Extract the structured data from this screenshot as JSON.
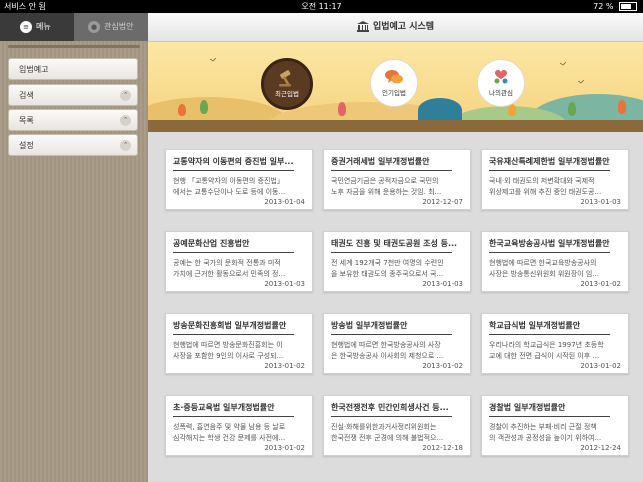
{
  "status_bar": {
    "carrier": "서비스 안 됨",
    "time": "오전 11:17",
    "battery": "72 %",
    "battery_level": 0.72
  },
  "sidebar": {
    "tabs": [
      {
        "label": "메뉴",
        "icon": "list-icon",
        "active": true
      },
      {
        "label": "관심법안",
        "icon": "person-icon",
        "active": false
      }
    ],
    "items": [
      {
        "label": "입법예고",
        "chevron": false
      },
      {
        "label": "검색",
        "chevron": true
      },
      {
        "label": "목록",
        "chevron": true
      },
      {
        "label": "설정",
        "chevron": true
      }
    ]
  },
  "header": {
    "title": "입법예고 시스템",
    "icon": "capitol-building-icon"
  },
  "banner": {
    "buttons": [
      {
        "label": "최근입법",
        "icon": "gavel-icon",
        "active": true
      },
      {
        "label": "인기입법",
        "icon": "chat-bubbles-icon",
        "active": false
      },
      {
        "label": "나의관심",
        "icon": "heart-person-icon",
        "active": false
      }
    ]
  },
  "cards": [
    {
      "title": "교통약자의 이동편의 증진법 일부...",
      "body1": "현행 「교통약자의 이동편의 증진법」",
      "body2": "에서는 교통수단이나 도로 등에 이동...",
      "date": "2013-01-04"
    },
    {
      "title": "증권거래세법 일부개정법률안",
      "body1": "국민연금기금은 공적자금으로 국민의",
      "body2": "노후 자금을 위해 운용하는 것임. 최...",
      "date": "2012-12-07"
    },
    {
      "title": "국유재산특례제한법 일부개정법률안",
      "body1": "국내·외 태권도의 저변확대와 국제적",
      "body2": "위상제고를 위해 추진 중인 태권도공...",
      "date": "2013-01-03"
    },
    {
      "title": "공예문화산업 진흥법안",
      "body1": "공예는 한 국가의 문화적 전통과 미적",
      "body2": "가치에 근거한 활동으로서 민족의 정...",
      "date": "2013-01-03"
    },
    {
      "title": "태권도 진흥 및 태권도공원 조성 등...",
      "body1": "전 세계 192개국 7천만 여명의 수련인",
      "body2": "을 보유한 태권도의 종주국으로서 국...",
      "date": "2013-01-03"
    },
    {
      "title": "한국교육방송공사법 일부개정법률안",
      "body1": "현행법에 따르면 한국교육방송공사의",
      "body2": "사장은 방송통신위원회 위원장이 임...",
      "date": "2013-01-02"
    },
    {
      "title": "방송문화진흥회법 일부개정법률안",
      "body1": "현행법에 따르면 방송문화진흥회는 이",
      "body2": "사장을 포함한 9인의 이사로 구성되...",
      "date": "2013-01-02"
    },
    {
      "title": "방송법 일부개정법률안",
      "body1": "현행법에 따르면 한국방송공사의 사장",
      "body2": "은 한국방송공사 이사회의 제청으로 ...",
      "date": "2013-01-02"
    },
    {
      "title": "학교급식법 일부개정법률안",
      "body1": "우리나라의 학교급식은 1997년 초등학",
      "body2": "교에 대한 전면 급식이 시작된 이후 ...",
      "date": "2013-01-02"
    },
    {
      "title": "초·중등교육법 일부개정법률안",
      "body1": "성폭력, 흡연음주 및 약물 남용 등 날로",
      "body2": "심각해지는 학생 건강 문제를 사전에...",
      "date": "2013-01-02"
    },
    {
      "title": "한국전쟁전후 민간인희생사건 등...",
      "body1": "진실·화해를위한과거사정리위원회는",
      "body2": "한국전쟁 전후 군경에 의해 불법적으...",
      "date": "2012-12-18"
    },
    {
      "title": "경찰법 일부개정법률안",
      "body1": "경찰이 추진하는 부패·비리 근절 정책",
      "body2": "의 객관성과 공정성을 높이기 위하여...",
      "date": "2012-12-24"
    }
  ]
}
